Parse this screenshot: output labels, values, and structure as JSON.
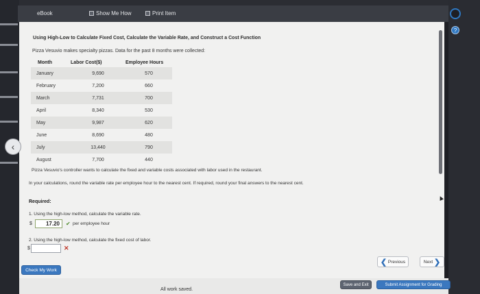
{
  "toolbar": {
    "ebook_label": "eBook",
    "show_me_how_label": "Show Me How",
    "print_item_label": "Print Item"
  },
  "problem": {
    "title": "Using High-Low to Calculate Fixed Cost, Calculate the Variable Rate, and Construct a Cost Function",
    "intro": "Pizza Vesuvio makes specialty pizzas. Data for the past 8 months were collected:",
    "table": {
      "headers": [
        "Month",
        "Labor Cost($)",
        "Employee Hours"
      ],
      "rows": [
        [
          "January",
          "9,690",
          "570"
        ],
        [
          "February",
          "7,200",
          "660"
        ],
        [
          "March",
          "7,731",
          "700"
        ],
        [
          "April",
          "8,340",
          "530"
        ],
        [
          "May",
          "9,987",
          "620"
        ],
        [
          "June",
          "8,690",
          "480"
        ],
        [
          "July",
          "13,440",
          "790"
        ],
        [
          "August",
          "7,700",
          "440"
        ]
      ]
    },
    "paragraph1": "Pizza Vesuvio's controller wants to calculate the fixed and variable costs associated with labor used in the restaurant.",
    "paragraph2": "In your calculations, round the variable rate per employee hour to the nearest cent. If required, round your final answers to the nearest cent.",
    "required_label": "Required:",
    "q1": {
      "text": "1.  Using the high-low method, calculate the variable rate.",
      "currency": "$",
      "value": "17.20",
      "unit": "per employee hour",
      "status": "correct"
    },
    "q2": {
      "text": "2.  Using the high-low method, calculate the fixed cost of labor.",
      "currency": "$",
      "value": "",
      "status": "incorrect"
    }
  },
  "nav": {
    "previous_label": "Previous",
    "next_label": "Next",
    "check_work_label": "Check My Work"
  },
  "footer": {
    "saved_status": "All work saved.",
    "save_exit_label": "Save and Exit",
    "submit_label": "Submit Assignment for Grading"
  },
  "colors": {
    "accent_blue": "#3b78bf",
    "correct_green": "#4f8a2b",
    "error_red": "#c0392b"
  }
}
